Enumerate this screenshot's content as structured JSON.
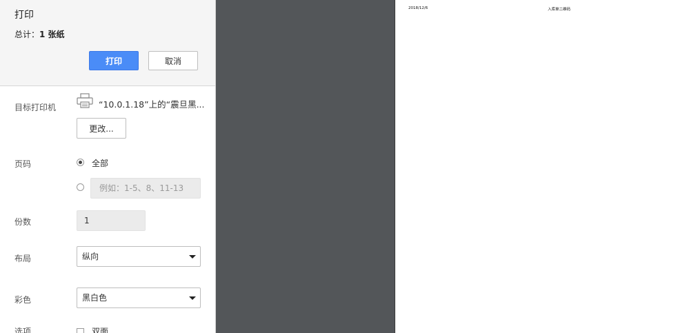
{
  "header": {
    "title": "打印",
    "total_label": "总计：",
    "total_value": "1 张纸",
    "print_button": "打印",
    "cancel_button": "取消"
  },
  "destination": {
    "label": "目标打印机",
    "printer_name": "“10.0.1.18”上的“震旦黑...",
    "change_button": "更改...",
    "icon": "printer-icon"
  },
  "pages": {
    "label": "页码",
    "option_all": "全部",
    "custom_placeholder": "例如：1-5、8、11-13",
    "selected": "all"
  },
  "copies": {
    "label": "份数",
    "value": "1"
  },
  "layout": {
    "label": "布局",
    "value": "纵向"
  },
  "color": {
    "label": "彩色",
    "value": "黑白色"
  },
  "options": {
    "label": "选项",
    "duplex_label": "双面",
    "duplex_checked": false
  },
  "preview": {
    "date": "2018/12/6",
    "title": "入库单二维码"
  },
  "colors": {
    "accent": "#4a8cf7",
    "preview_background": "#535659",
    "header_background": "#f5f5f5"
  }
}
